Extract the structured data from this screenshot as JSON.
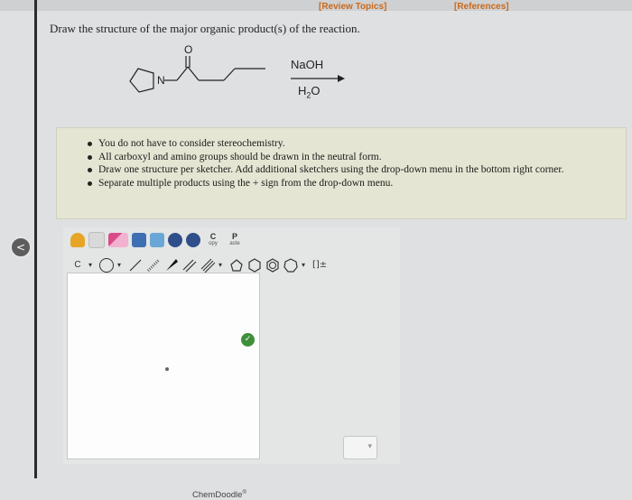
{
  "header": {
    "review_topics": "[Review Topics]",
    "references": "[References]"
  },
  "question": "Draw the structure of the major organic product(s) of the reaction.",
  "scheme": {
    "atom_O": "O",
    "atom_N": "N",
    "reagent_top": "NaOH",
    "reagent_bottom_main": "H",
    "reagent_bottom_sub": "2",
    "reagent_bottom_tail": "O"
  },
  "notes": [
    "You do not have to consider stereochemistry.",
    "All carboxyl and amino groups should be drawn in the neutral form.",
    "Draw one structure per sketcher. Add additional sketchers using the drop-down menu in the bottom right corner.",
    "Separate multiple products using the + sign from the drop-down menu."
  ],
  "sketcher": {
    "copy_top": "C",
    "copy_bottom": "opy",
    "paste_top": "P",
    "paste_bottom": "aste",
    "carbon_label": "C",
    "bracket_label": "[]±",
    "brand": "ChemDoodle",
    "brand_mark": "®"
  },
  "dropdown_arrow": "▾",
  "back_arrow": "<",
  "ok_mark": "✓",
  "colors": {
    "link": "#c96a1b",
    "note_bg": "#e5e5d3",
    "ok": "#3e8f3a"
  }
}
